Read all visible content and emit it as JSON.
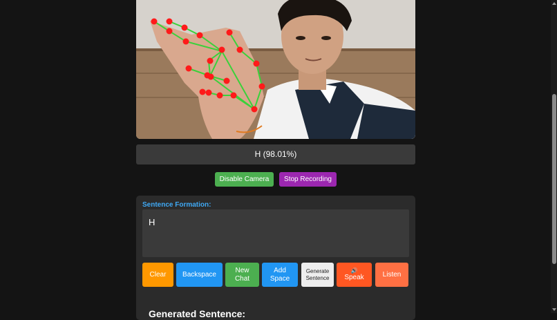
{
  "prediction": {
    "text": "H (98.01%)"
  },
  "camera_controls": {
    "disable_camera": "Disable Camera",
    "stop_recording": "Stop Recording"
  },
  "sentence": {
    "label": "Sentence Formation:",
    "value": "H"
  },
  "action_buttons": {
    "clear": "Clear",
    "backspace": "Backspace",
    "new_chat_line1": "New",
    "new_chat_line2": "Chat",
    "add_space_line1": "Add",
    "add_space_line2": "Space",
    "generate_line1": "Generate",
    "generate_line2": "Sentence",
    "speak_icon": "🔊",
    "speak": "Speak",
    "listen": "Listen"
  },
  "generated": {
    "heading": "Generated Sentence:"
  },
  "colors": {
    "green": "#4caf50",
    "purple": "#9c27b0",
    "orange": "#ff9800",
    "blue": "#2196f3",
    "deep_orange": "#ff5722",
    "salmon": "#ff7043",
    "accent_label": "#3fa9f5"
  }
}
